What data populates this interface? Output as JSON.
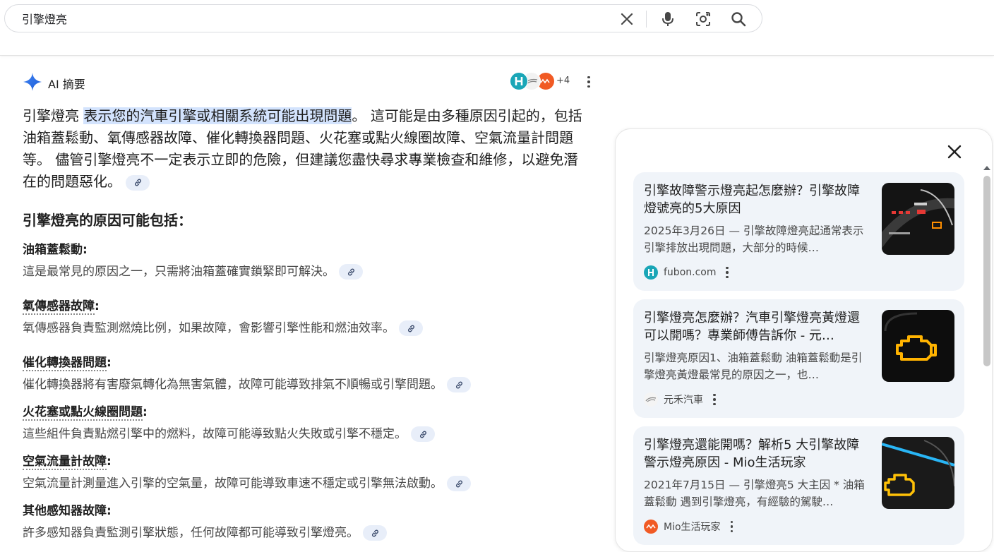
{
  "search": {
    "query": "引擎燈亮"
  },
  "ai_overview": {
    "title": "AI 摘要",
    "source_more": "+4",
    "summary": {
      "lead": "引擎燈亮",
      "highlight": "表示您的汽車引擎或相關系統可能出現問題",
      "rest": "。 這可能是由多種原因引起的，包括油箱蓋鬆動、氧傳感器故障、催化轉換器問題、火花塞或點火線圈故障、空氣流量計問題等。 儘管引擎燈亮不一定表示立即的危險，但建議您盡快尋求專業檢查和維修，以避免潛在的問題惡化。"
    },
    "reasons_heading": "引擎燈亮的原因可能包括：",
    "reasons": [
      {
        "title": "油箱蓋鬆動",
        "desc": "這是最常見的原因之一，只需將油箱蓋確實鎖緊即可解決。"
      },
      {
        "title": "氧傳感器故障",
        "desc": "氧傳感器負責監測燃燒比例，如果故障，會影響引擎性能和燃油效率。"
      },
      {
        "title": "催化轉換器問題",
        "desc": "催化轉換器將有害廢氣轉化為無害氣體，故障可能導致排氣不順暢或引擎問題。"
      },
      {
        "title": "火花塞或點火線圈問題",
        "desc": "這些組件負責點燃引擎中的燃料，故障可能導致點火失敗或引擎不穩定。"
      },
      {
        "title": "空氣流量計故障",
        "desc": "空氣流量計測量進入引擎的空氣量，故障可能導致車速不穩定或引擎無法啟動。"
      },
      {
        "title": "其他感知器故障",
        "desc": "許多感知器負責監測引擎狀態，任何故障都可能導致引擎燈亮。"
      }
    ]
  },
  "sources": [
    {
      "title": "引擎故障警示燈亮起怎麼辦？引擎故障燈號亮的5大原因",
      "snippet": "2025年3月26日 — 引擎故障燈亮起通常表示引擎排放出現問題，大部分的時候…",
      "source": "fubon.com",
      "favicon_color": "#1aa6b7"
    },
    {
      "title": "引擎燈亮怎麼辦？汽車引擎燈亮黃燈還可以開嗎？專業師傅告訴你 - 元…",
      "snippet": "引擎燈亮原因1、油箱蓋鬆動 油箱蓋鬆動是引擎燈亮黃燈最常見的原因之一，也…",
      "source": "元禾汽車",
      "favicon_color": "#e8e8e8"
    },
    {
      "title": "引擎燈亮還能開嗎？解析5 大引擎故障警示燈亮原因 - Mio生活玩家",
      "snippet": "2021年7月15日 — 引擎燈亮5 大主因 * 油箱蓋鬆動 遇到引擎燈亮，有經驗的駕駛…",
      "source": "Mio生活玩家",
      "favicon_color": "#f15a24"
    }
  ],
  "colors": {
    "accent": "#1a73e8",
    "highlight": "#d3e3fd",
    "card_bg": "#f0f4f9"
  }
}
